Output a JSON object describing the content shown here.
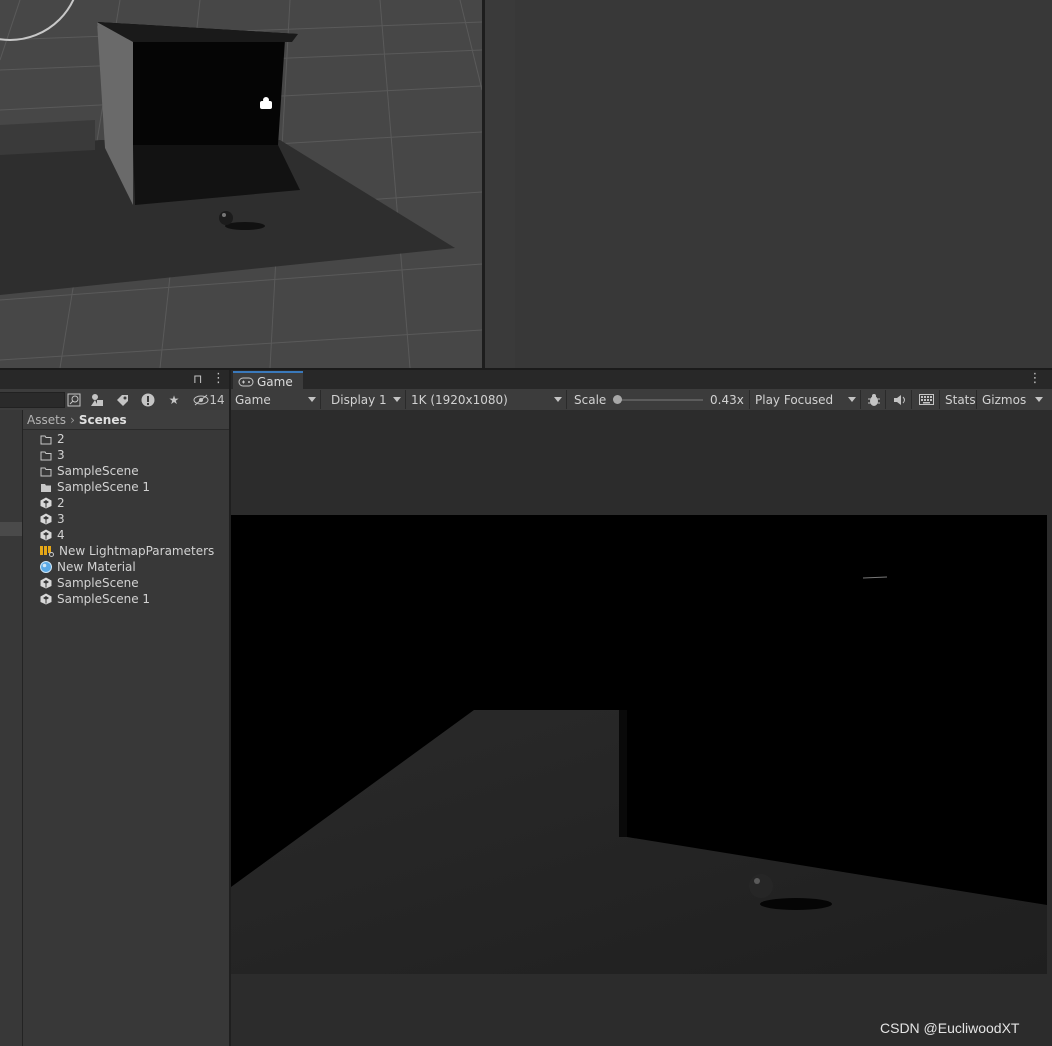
{
  "project": {
    "hidden_count": "14",
    "breadcrumb": {
      "root": "Assets",
      "current": "Scenes"
    },
    "items": [
      {
        "label": "2",
        "icon": "folder-outline-icon"
      },
      {
        "label": "3",
        "icon": "folder-outline-icon"
      },
      {
        "label": "SampleScene",
        "icon": "folder-outline-icon"
      },
      {
        "label": "SampleScene 1",
        "icon": "folder-filled-icon"
      },
      {
        "label": "2",
        "icon": "unity-scene-icon"
      },
      {
        "label": "3",
        "icon": "unity-scene-icon"
      },
      {
        "label": "4",
        "icon": "unity-scene-icon"
      },
      {
        "label": "New LightmapParameters",
        "icon": "lightmap-parameters-icon"
      },
      {
        "label": "New Material",
        "icon": "material-sphere-icon"
      },
      {
        "label": "SampleScene",
        "icon": "unity-scene-icon"
      },
      {
        "label": "SampleScene 1",
        "icon": "unity-scene-icon"
      }
    ]
  },
  "game": {
    "tab_label": "Game",
    "view_mode": "Game",
    "display": "Display 1",
    "resolution": "1K (1920x1080)",
    "scale_label": "Scale",
    "scale_value": "0.43x",
    "scale_fraction": 0.0,
    "play_mode": "Play Focused",
    "stats_label": "Stats",
    "gizmos_label": "Gizmos"
  },
  "watermark": "CSDN @EucliwoodXT",
  "colors": {
    "tab_accent": "#3a79bb",
    "panel_bg": "#383838",
    "toolbar_bg": "#3c3c3c",
    "lightmap_icon": "#e6a817",
    "material_icon": "#5aa9e6"
  }
}
